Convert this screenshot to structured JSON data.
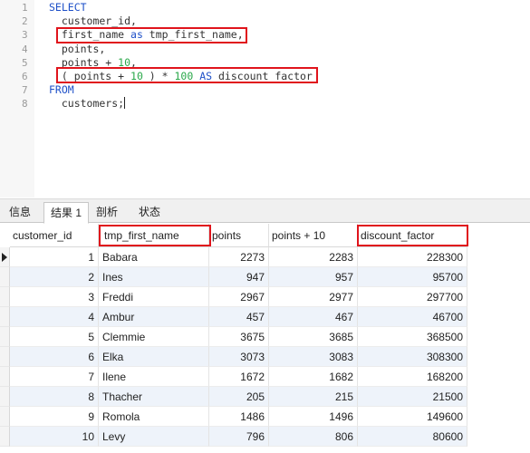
{
  "editor": {
    "lines": [
      {
        "n": "1",
        "tokens": [
          {
            "t": "SELECT",
            "c": "kw"
          }
        ]
      },
      {
        "n": "2",
        "tokens": [
          {
            "t": "  customer_id,",
            "c": ""
          }
        ]
      },
      {
        "n": "3",
        "tokens": [
          {
            "t": "  first_name ",
            "c": ""
          },
          {
            "t": "as",
            "c": "kw"
          },
          {
            "t": " tmp_first_name,",
            "c": ""
          }
        ]
      },
      {
        "n": "4",
        "tokens": [
          {
            "t": "  points,",
            "c": ""
          }
        ]
      },
      {
        "n": "5",
        "tokens": [
          {
            "t": "  points + ",
            "c": ""
          },
          {
            "t": "10",
            "c": "num"
          },
          {
            "t": ",",
            "c": ""
          }
        ]
      },
      {
        "n": "6",
        "tokens": [
          {
            "t": "  ( points + ",
            "c": ""
          },
          {
            "t": "10",
            "c": "num"
          },
          {
            "t": " ) * ",
            "c": ""
          },
          {
            "t": "100",
            "c": "num"
          },
          {
            "t": " ",
            "c": ""
          },
          {
            "t": "AS",
            "c": "kw"
          },
          {
            "t": " discount_factor",
            "c": ""
          }
        ]
      },
      {
        "n": "7",
        "tokens": [
          {
            "t": "FROM",
            "c": "kw"
          }
        ]
      },
      {
        "n": "8",
        "tokens": [
          {
            "t": "  customers;",
            "c": ""
          }
        ]
      }
    ]
  },
  "tabs": [
    {
      "label": "信息",
      "active": false
    },
    {
      "label": "结果 1",
      "active": true
    },
    {
      "label": "剖析",
      "active": false
    },
    {
      "label": "状态",
      "active": false
    }
  ],
  "grid": {
    "columns": [
      "customer_id",
      "tmp_first_name",
      "points",
      "points + 10",
      "discount_factor"
    ],
    "rows": [
      [
        "1",
        "Babara",
        "2273",
        "2283",
        "228300"
      ],
      [
        "2",
        "Ines",
        "947",
        "957",
        "95700"
      ],
      [
        "3",
        "Freddi",
        "2967",
        "2977",
        "297700"
      ],
      [
        "4",
        "Ambur",
        "457",
        "467",
        "46700"
      ],
      [
        "5",
        "Clemmie",
        "3675",
        "3685",
        "368500"
      ],
      [
        "6",
        "Elka",
        "3073",
        "3083",
        "308300"
      ],
      [
        "7",
        "Ilene",
        "1672",
        "1682",
        "168200"
      ],
      [
        "8",
        "Thacher",
        "205",
        "215",
        "21500"
      ],
      [
        "9",
        "Romola",
        "1486",
        "1496",
        "149600"
      ],
      [
        "10",
        "Levy",
        "796",
        "806",
        "80600"
      ]
    ],
    "current_row": 0
  },
  "colors": {
    "keyword": "#1e50c8",
    "number": "#2aa84a",
    "highlight_box": "#e0141c",
    "alt_row": "#eef3fa"
  }
}
